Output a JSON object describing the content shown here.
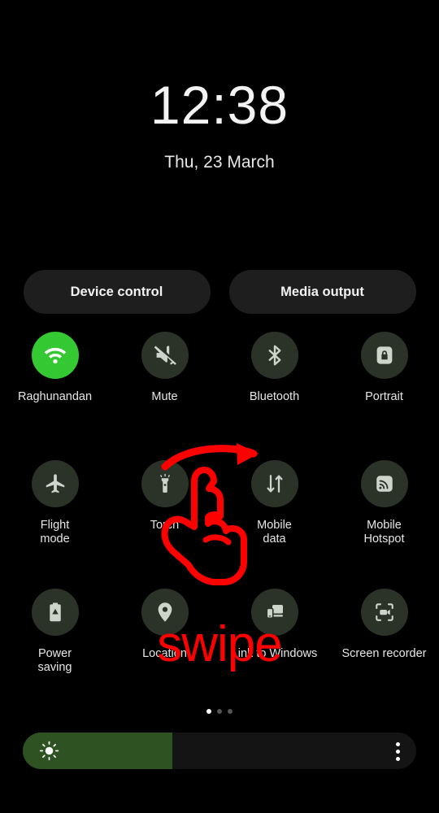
{
  "clock": {
    "time": "12:38",
    "date": "Thu, 23 March"
  },
  "quick_buttons": [
    {
      "label": "Device control",
      "name": "device-control-button"
    },
    {
      "label": "Media output",
      "name": "media-output-button"
    }
  ],
  "tiles": [
    [
      {
        "label": "Raghunandan",
        "icon": "wifi-icon",
        "state": "on"
      },
      {
        "label": "Mute",
        "icon": "mute-icon",
        "state": "off"
      },
      {
        "label": "Bluetooth",
        "icon": "bluetooth-icon",
        "state": "off"
      },
      {
        "label": "Portrait",
        "icon": "rotation-lock-icon",
        "state": "off"
      }
    ],
    [
      {
        "label": "Flight\nmode",
        "icon": "airplane-icon",
        "state": "off"
      },
      {
        "label": "Torch",
        "icon": "flashlight-icon",
        "state": "off"
      },
      {
        "label": "Mobile\ndata",
        "icon": "mobile-data-icon",
        "state": "off"
      },
      {
        "label": "Mobile\nHotspot",
        "icon": "hotspot-icon",
        "state": "off"
      }
    ],
    [
      {
        "label": "Power\nsaving",
        "icon": "battery-saver-icon",
        "state": "off"
      },
      {
        "label": "Location",
        "icon": "location-pin-icon",
        "state": "off"
      },
      {
        "label": "Link to Windows",
        "icon": "link-to-windows-icon",
        "state": "off"
      },
      {
        "label": "Screen recorder",
        "icon": "screen-recorder-icon",
        "state": "off"
      }
    ]
  ],
  "pagination": {
    "total": 3,
    "active_index": 0
  },
  "brightness": {
    "icon": "brightness-sun-icon",
    "fill_percent": 38,
    "menu_icon": "overflow-menu-icon"
  },
  "annotation": {
    "swipe_label": "swipe",
    "color": "#fd0000",
    "gesture": "hand-pointing-swipe-right"
  },
  "colors": {
    "background": "#000000",
    "tile_off": "#2b3329",
    "tile_on": "#34c832",
    "pill": "#1e1e1e",
    "slider_fill": "#2e5222",
    "slider_track": "#141414",
    "annotation_red": "#fd0000"
  }
}
